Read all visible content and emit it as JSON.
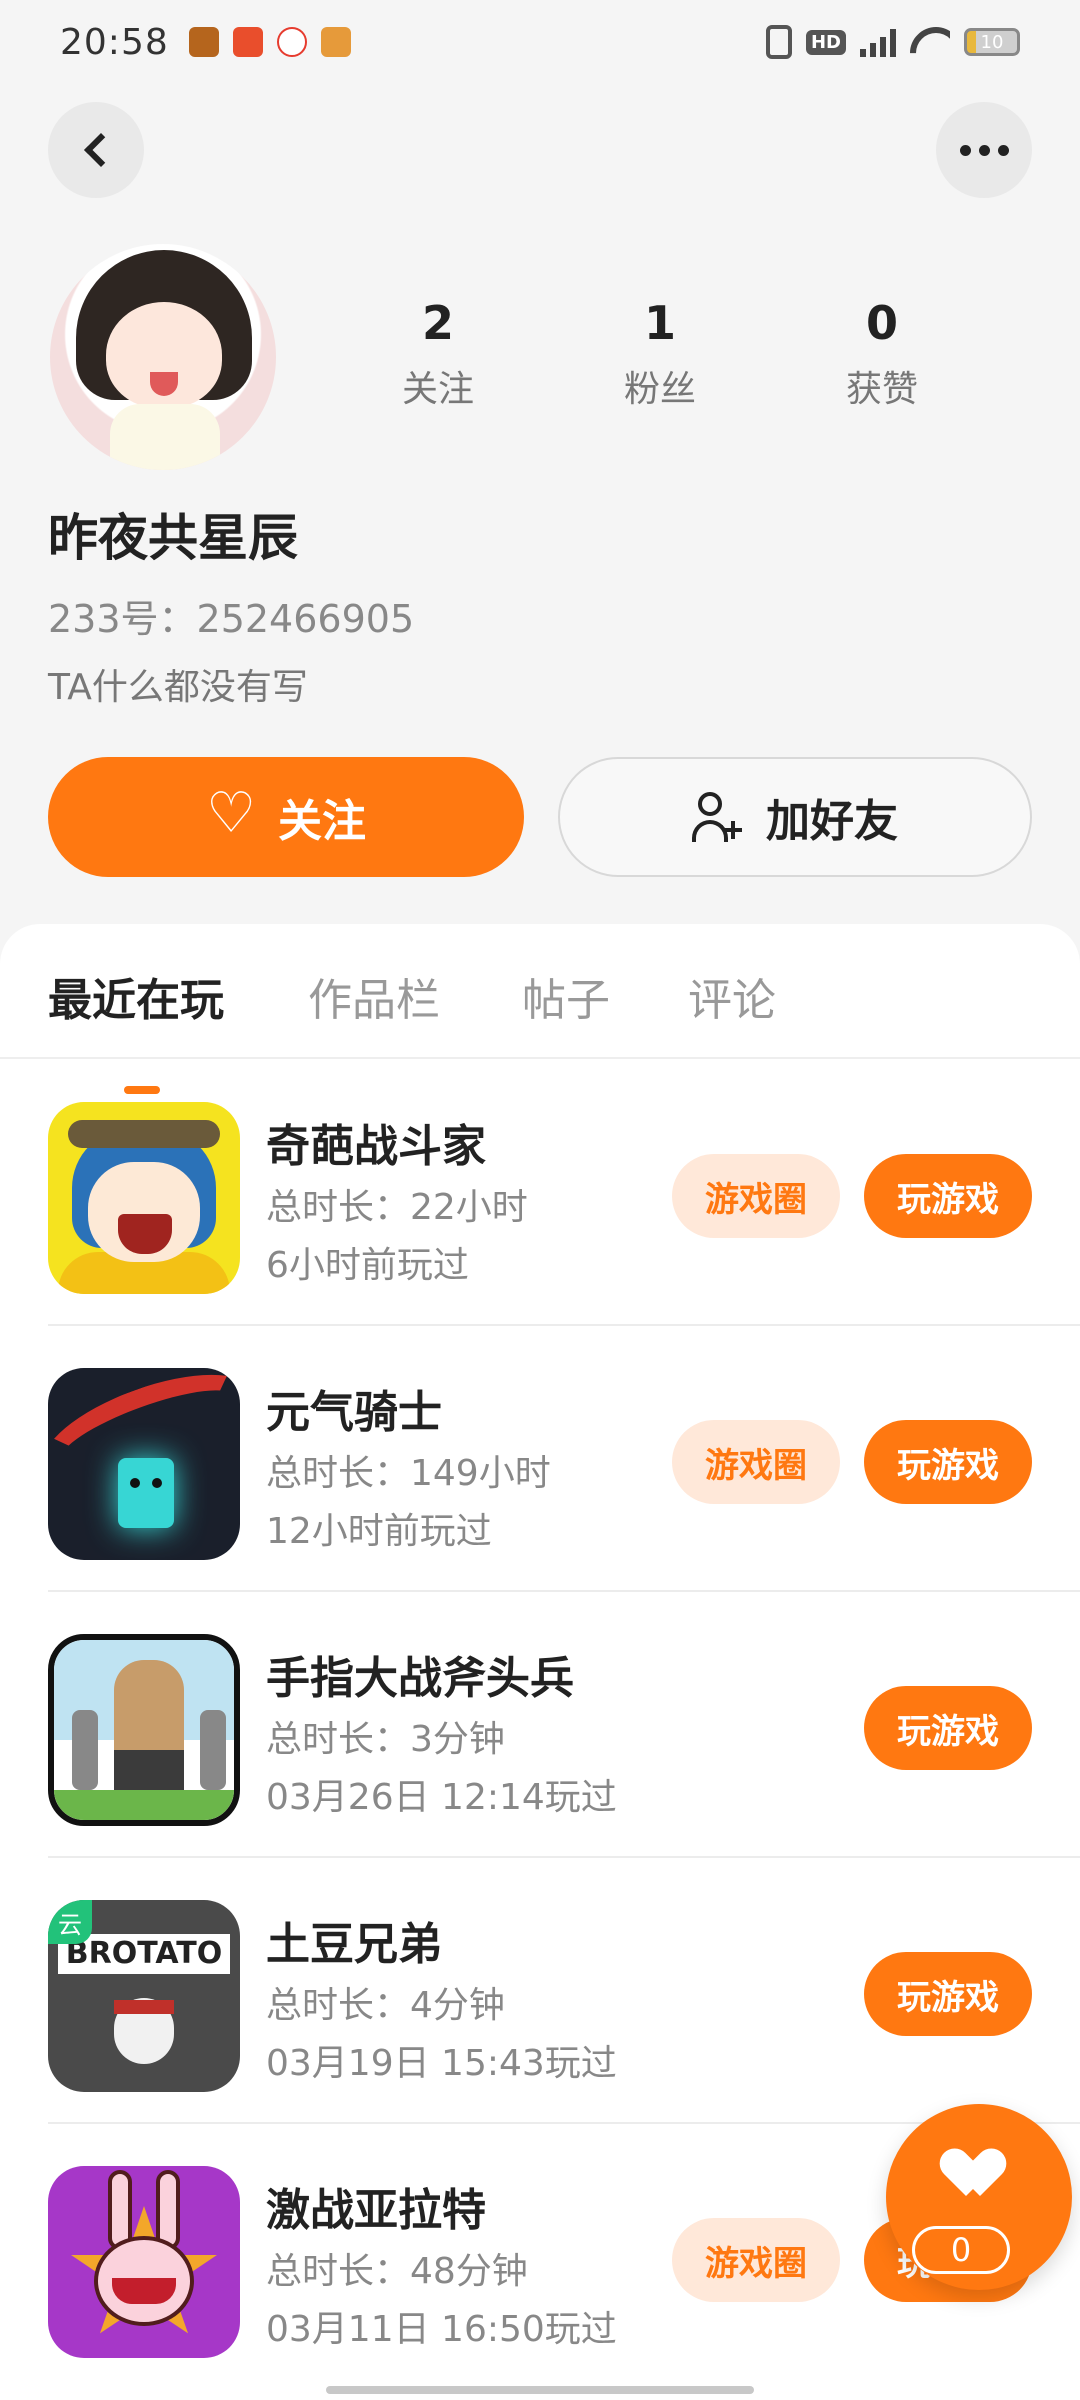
{
  "status_bar": {
    "time": "20:58",
    "battery": "10",
    "network": "4G",
    "hd": "HD"
  },
  "profile": {
    "stats": [
      {
        "num": "2",
        "label": "关注"
      },
      {
        "num": "1",
        "label": "粉丝"
      },
      {
        "num": "0",
        "label": "获赞"
      }
    ],
    "nickname": "昨夜共星辰",
    "uid": "233号：252466905",
    "bio": "TA什么都没有写",
    "follow_label": "关注",
    "add_friend_label": "加好友"
  },
  "tabs": [
    {
      "label": "最近在玩",
      "active": true
    },
    {
      "label": "作品栏",
      "active": false
    },
    {
      "label": "帖子",
      "active": false
    },
    {
      "label": "评论",
      "active": false
    }
  ],
  "games": [
    {
      "name": "奇葩战斗家",
      "duration": "总时长：22小时",
      "last_played": "6小时前玩过",
      "circle_label": "游戏圈",
      "play_label": "玩游戏"
    },
    {
      "name": "元气骑士",
      "duration": "总时长：149小时",
      "last_played": "12小时前玩过",
      "circle_label": "游戏圈",
      "play_label": "玩游戏"
    },
    {
      "name": "手指大战斧头兵",
      "duration": "总时长：3分钟",
      "last_played": "03月26日 12:14玩过",
      "circle_label": "",
      "play_label": "玩游戏"
    },
    {
      "name": "土豆兄弟",
      "duration": "总时长：4分钟",
      "last_played": "03月19日 15:43玩过",
      "circle_label": "",
      "play_label": "玩游戏",
      "icon_text": "BROTATO",
      "icon_tag": "云"
    },
    {
      "name": "激战亚拉特",
      "duration": "总时长：48分钟",
      "last_played": "03月11日 16:50玩过",
      "circle_label": "游戏圈",
      "play_label": "玩游戏"
    }
  ],
  "like_fab": {
    "count": "0"
  },
  "colors": {
    "accent": "#ff7811",
    "chip_bg": "#ffe8d9"
  }
}
